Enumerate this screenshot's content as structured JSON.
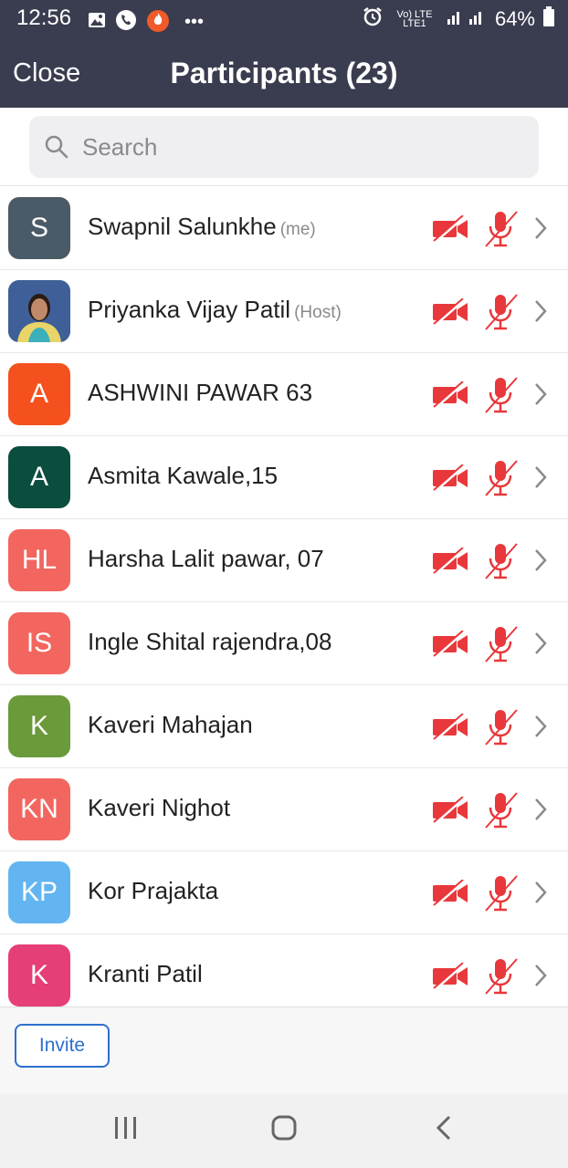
{
  "status_bar": {
    "time": "12:56",
    "left_icons": [
      "image-icon",
      "phone-icon",
      "fire-icon",
      "more-dots-icon"
    ],
    "network": "Vo) LTE LTE1",
    "battery": "64%"
  },
  "header": {
    "close_label": "Close",
    "title": "Participants (23)"
  },
  "search": {
    "placeholder": "Search",
    "value": ""
  },
  "participants": [
    {
      "initials": "S",
      "avatar_color": "#4a5a66",
      "name": "Swapnil Salunkhe",
      "tag": "(me)",
      "video": "off",
      "audio": "muted"
    },
    {
      "initials": "",
      "avatar_color": "#5a6f8c",
      "avatar_type": "photo",
      "name": "Priyanka Vijay Patil",
      "tag": "(Host)",
      "video": "off",
      "audio": "muted"
    },
    {
      "initials": "A",
      "avatar_color": "#f4511e",
      "name": "ASHWINI PAWAR 63",
      "tag": "",
      "video": "off",
      "audio": "muted"
    },
    {
      "initials": "A",
      "avatar_color": "#0b4d3e",
      "name": "Asmita Kawale,15",
      "tag": "",
      "video": "off",
      "audio": "muted"
    },
    {
      "initials": "HL",
      "avatar_color": "#f2665f",
      "name": "Harsha Lalit pawar, 07",
      "tag": "",
      "video": "off",
      "audio": "muted"
    },
    {
      "initials": "IS",
      "avatar_color": "#f2665f",
      "name": "Ingle Shital rajendra,08",
      "tag": "",
      "video": "off",
      "audio": "muted"
    },
    {
      "initials": "K",
      "avatar_color": "#6a9a3a",
      "name": "Kaveri Mahajan",
      "tag": "",
      "video": "off",
      "audio": "muted"
    },
    {
      "initials": "KN",
      "avatar_color": "#f2665f",
      "name": "Kaveri Nighot",
      "tag": "",
      "video": "off",
      "audio": "muted"
    },
    {
      "initials": "KP",
      "avatar_color": "#62b5f0",
      "name": "Kor Prajakta",
      "tag": "",
      "video": "off",
      "audio": "muted"
    },
    {
      "initials": "K",
      "avatar_color": "#e63e77",
      "name": "Kranti Patil",
      "tag": "",
      "video": "off",
      "audio": "muted"
    }
  ],
  "footer": {
    "invite_label": "Invite"
  },
  "colors": {
    "header_bg": "#3a3d4f",
    "muted_red": "#e8383b",
    "invite_blue": "#2d6fce"
  },
  "nav_bar": [
    "recent-apps-icon",
    "home-icon",
    "back-icon"
  ]
}
